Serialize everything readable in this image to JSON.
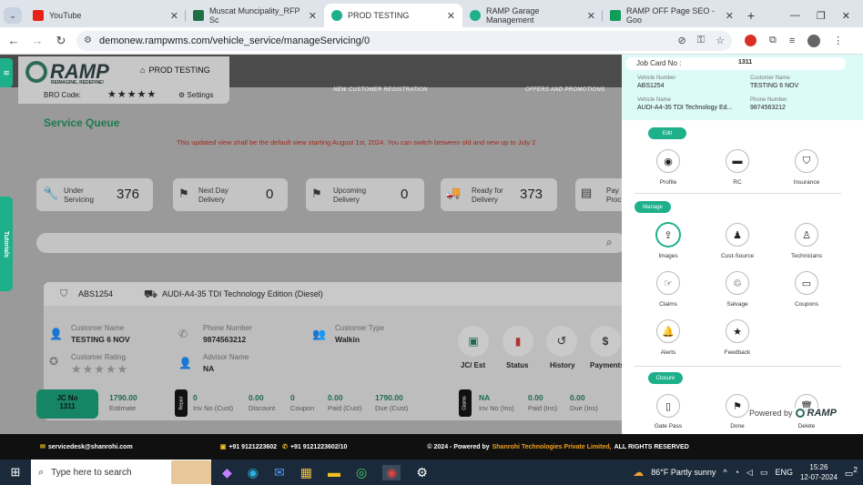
{
  "browser": {
    "tabs": [
      {
        "title": "YouTube",
        "color": "#e62117"
      },
      {
        "title": "Muscat Muncipality_RFP Sc",
        "color": "#1e7145"
      },
      {
        "title": "PROD TESTING",
        "color": "#1eb08b",
        "active": true
      },
      {
        "title": "RAMP Garage Management",
        "color": "#1eb08b"
      },
      {
        "title": "RAMP OFF Page SEO - Goo",
        "color": "#0f9d58"
      }
    ],
    "url": "demonew.rampwms.com/vehicle_service/manageServicing/0"
  },
  "app": {
    "header_title": "PROD TESTING",
    "logo_text": "RAMP",
    "logo_tagline": "REIMAGINE, REDEFINE!",
    "bro_code_label": "BRO Code:",
    "settings_label": "Settings",
    "nav": [
      "NEW CUSTOMER REGISTRATION",
      "OFFERS AND PROMOTIONS"
    ],
    "section_title": "Service Queue",
    "notice": "This updated view shall be the default view starting August 1st, 2024. You can switch between old and new up to July 2",
    "tutorials_label": "Tutorials",
    "stats": [
      {
        "label1": "Under",
        "label2": "Servicing",
        "value": "376"
      },
      {
        "label1": "Next Day",
        "label2": "Delivery",
        "value": "0"
      },
      {
        "label1": "Upcoming",
        "label2": "Delivery",
        "value": "0"
      },
      {
        "label1": "Ready for",
        "label2": "Delivery",
        "value": "373"
      },
      {
        "label1": "Pay",
        "label2": "Proc",
        "value": ""
      }
    ],
    "vehicle": {
      "number": "ABS1254",
      "model": "AUDI-A4-35 TDI Technology Edition (Diesel)",
      "customer_name_label": "Customer Name",
      "customer_name": "TESTING 6 NOV",
      "phone_label": "Phone Number",
      "phone": "9874563212",
      "customer_type_label": "Customer Type",
      "customer_type": "Walkin",
      "rating_label": "Customer Rating",
      "advisor_label": "Advisor Name",
      "advisor": "NA",
      "actions": [
        "JC/ Est",
        "Status",
        "History",
        "Payments"
      ]
    },
    "jc": {
      "label": "JC No",
      "number": "1311",
      "estimate_value": "1790.00",
      "estimate_label": "Estimate",
      "repair_tag": "Repair",
      "repair_cols": [
        {
          "value": "0",
          "label": "Inv No (Cust)"
        },
        {
          "value": "0.00",
          "label": "Discount"
        },
        {
          "value": "0",
          "label": "Coupon"
        },
        {
          "value": "0.00",
          "label": "Paid (Cust)"
        },
        {
          "value": "1790.00",
          "label": "Due (Cust)"
        }
      ],
      "claims_tag": "Claims",
      "claims_cols": [
        {
          "value": "NA",
          "label": "Inv No (Ins)"
        },
        {
          "value": "0.00",
          "label": "Paid (Ins)"
        },
        {
          "value": "0.00",
          "label": "Due (Ins)"
        }
      ]
    }
  },
  "panel": {
    "job_card_label": "Job Card No :",
    "job_card_no": "1311",
    "vehicle_number_label": "Vehicle Number",
    "vehicle_number": "ABS1254",
    "customer_name_label": "Customer Name",
    "customer_name": "TESTING 6 NOV",
    "vehicle_name_label": "Vehicle Name",
    "vehicle_name": "AUDI-A4-35 TDI Technology Ed...",
    "phone_label": "Phone Number",
    "phone": "9874563212",
    "edit_label": "Edit",
    "edit_items": [
      "Profile",
      "RC",
      "Insurance"
    ],
    "manage_label": "Manage",
    "manage_items": [
      "Images",
      "Cust-Source",
      "Technicians",
      "Claims",
      "Salvage",
      "Coupons",
      "Alerts",
      "Feedback"
    ],
    "closure_label": "Closure",
    "closure_items": [
      "Gate Pass",
      "Done",
      "Delete"
    ],
    "powered_by": "Powered by",
    "powered_brand": "RAMP"
  },
  "footer": {
    "email": "servicedesk@shanrohi.com",
    "whatsapp": "+91 9121223602",
    "phone": "+91 9121223602/10",
    "copyright_prefix": "© 2024 - Powered by",
    "company": "Shanrohi Technologies Private Limited,",
    "rights": "ALL RIGHTS RESERVED"
  },
  "taskbar": {
    "search_placeholder": "Type here to search",
    "weather": "86°F  Partly sunny",
    "lang": "ENG",
    "time": "15:26",
    "date": "12-07-2024",
    "notifications": "2"
  },
  "colors": {
    "accent": "#1eb08b",
    "notice": "#c0392b",
    "title_green": "#1e8f5f"
  }
}
